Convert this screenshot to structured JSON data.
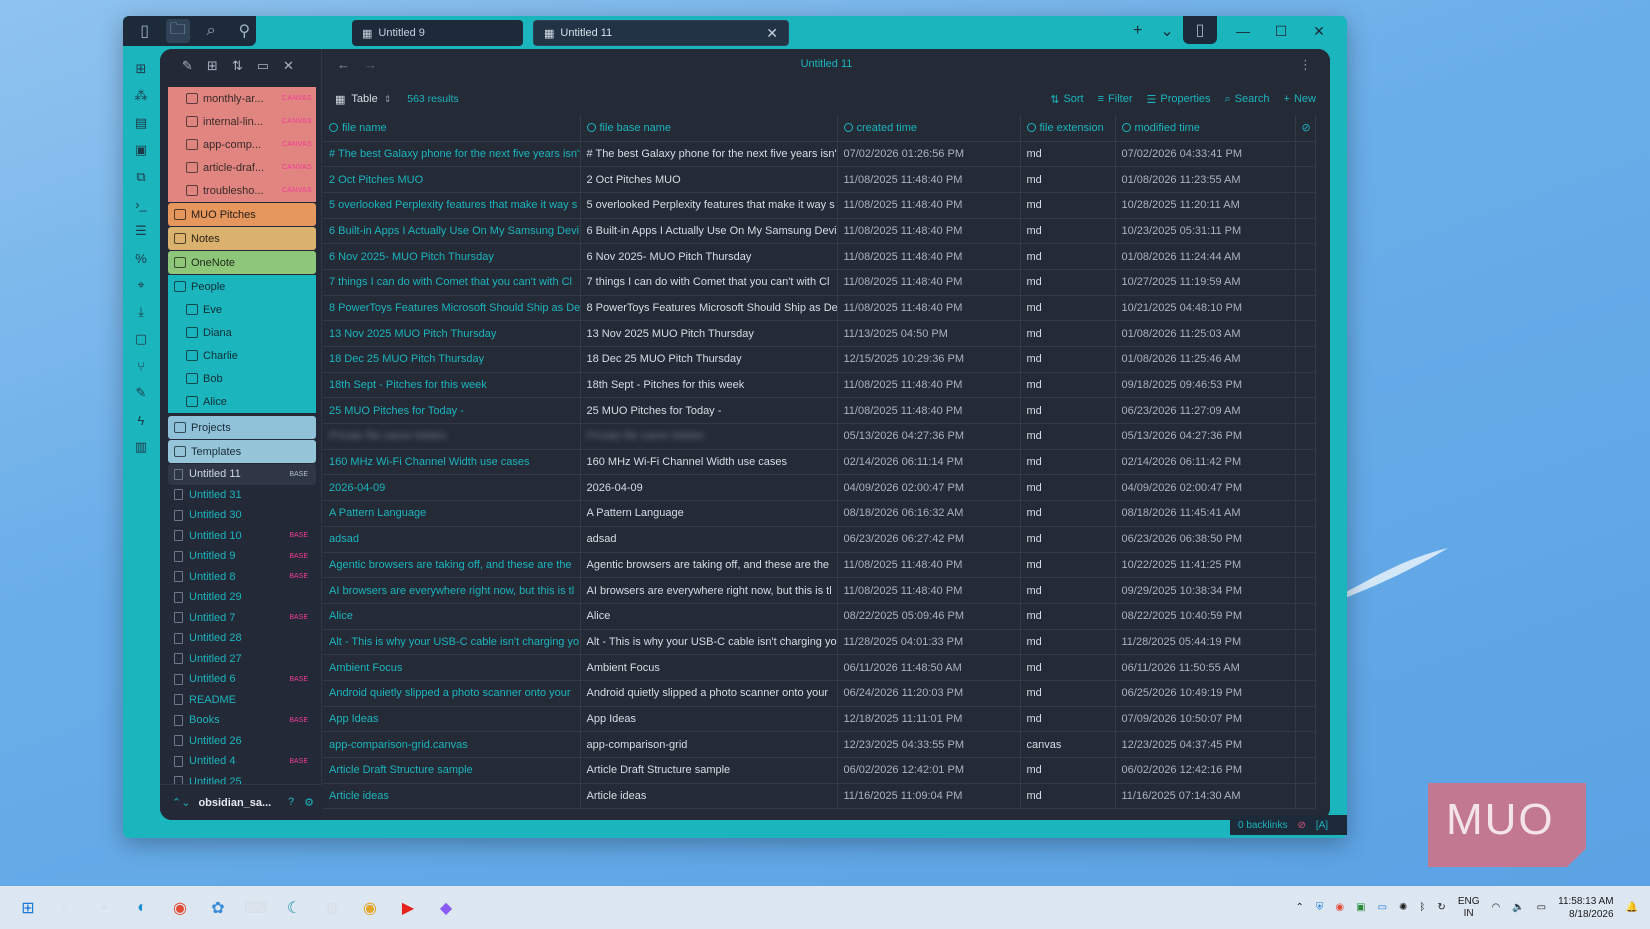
{
  "titlebar": {
    "tabs": [
      {
        "label": "Untitled 9"
      },
      {
        "label": "Untitled 11"
      }
    ],
    "close_glyph": "✕",
    "new_tab": "+",
    "tab_list": "⌄"
  },
  "ribbon_icons": [
    "files-icon",
    "graph-icon",
    "page-icon",
    "calendar-icon",
    "copy-icon",
    "terminal-icon",
    "blocks-icon",
    "percent-icon",
    "map-pin-icon",
    "download-icon",
    "robot-icon",
    "branch-icon",
    "brush-icon",
    "bolt-icon",
    "clipboard-icon"
  ],
  "sidebar": {
    "red_group": [
      {
        "label": "monthly-ar...",
        "badge": "CANVAS"
      },
      {
        "label": "internal-lin...",
        "badge": "CANVAS"
      },
      {
        "label": "app-comp...",
        "badge": "CANVAS"
      },
      {
        "label": "article-draf...",
        "badge": "CANVAS"
      },
      {
        "label": "troublesho...",
        "badge": "CANVAS"
      }
    ],
    "folders_top": [
      {
        "label": "MUO Pitches",
        "style": "f-orange"
      },
      {
        "label": "Notes",
        "style": "f-yellow"
      },
      {
        "label": "OneNote",
        "style": "f-green"
      }
    ],
    "people": {
      "label": "People",
      "items": [
        "Eve",
        "Diana",
        "Charlie",
        "Bob",
        "Alice"
      ]
    },
    "folders_bottom": [
      {
        "label": "Projects",
        "style": "f-blue"
      },
      {
        "label": "Templates",
        "style": "f-lightblue"
      }
    ],
    "files": [
      {
        "label": "Untitled 11",
        "badge": "BASE",
        "active": true
      },
      {
        "label": "Untitled 31",
        "badge": ""
      },
      {
        "label": "Untitled 30",
        "badge": ""
      },
      {
        "label": "Untitled 10",
        "badge": "BASE"
      },
      {
        "label": "Untitled 9",
        "badge": "BASE"
      },
      {
        "label": "Untitled 8",
        "badge": "BASE"
      },
      {
        "label": "Untitled 29",
        "badge": ""
      },
      {
        "label": "Untitled 7",
        "badge": "BASE"
      },
      {
        "label": "Untitled 28",
        "badge": ""
      },
      {
        "label": "Untitled 27",
        "badge": ""
      },
      {
        "label": "Untitled 6",
        "badge": "BASE"
      },
      {
        "label": "README",
        "badge": ""
      },
      {
        "label": "Books",
        "badge": "BASE"
      },
      {
        "label": "Untitled 26",
        "badge": ""
      },
      {
        "label": "Untitled 4",
        "badge": "BASE"
      },
      {
        "label": "Untitled 25",
        "badge": ""
      }
    ],
    "vault_name": "obsidian_sa..."
  },
  "main": {
    "title": "Untitled 11",
    "view_label": "Table",
    "results": "563 results",
    "actions": {
      "sort": "Sort",
      "filter": "Filter",
      "properties": "Properties",
      "search": "Search",
      "new": "New"
    },
    "columns": [
      "file name",
      "file base name",
      "created time",
      "file extension",
      "modified time"
    ],
    "rows": [
      [
        "# The best Galaxy phone for the next five years isn't",
        "# The best Galaxy phone for the next five years isn't",
        "07/02/2026 01:26:56 PM",
        "md",
        "07/02/2026 04:33:41 PM"
      ],
      [
        "2 Oct Pitches MUO",
        "2 Oct Pitches MUO",
        "11/08/2025 11:48:40 PM",
        "md",
        "01/08/2026 11:23:55 AM"
      ],
      [
        "5 overlooked Perplexity features that make it way s",
        "5 overlooked Perplexity features that make it way s",
        "11/08/2025 11:48:40 PM",
        "md",
        "10/28/2025 11:20:11 AM"
      ],
      [
        "6 Built-in Apps I Actually Use On My Samsung Devi",
        "6 Built-in Apps I Actually Use On My Samsung Devi",
        "11/08/2025 11:48:40 PM",
        "md",
        "10/23/2025 05:31:11 PM"
      ],
      [
        "6 Nov 2025- MUO Pitch Thursday",
        "6 Nov 2025- MUO Pitch Thursday",
        "11/08/2025 11:48:40 PM",
        "md",
        "01/08/2026 11:24:44 AM"
      ],
      [
        "7 things I can do with Comet that you can't with Cl",
        "7 things I can do with Comet that you can't with Cl",
        "11/08/2025 11:48:40 PM",
        "md",
        "10/27/2025 11:19:59 AM"
      ],
      [
        "8 PowerToys Features Microsoft Should Ship as De",
        "8 PowerToys Features Microsoft Should Ship as De",
        "11/08/2025 11:48:40 PM",
        "md",
        "10/21/2025 04:48:10 PM"
      ],
      [
        "13 Nov 2025 MUO Pitch Thursday",
        "13 Nov 2025 MUO Pitch Thursday",
        "11/13/2025 04:50 PM",
        "md",
        "01/08/2026 11:25:03 AM"
      ],
      [
        "18 Dec 25 MUO Pitch Thursday",
        "18 Dec 25 MUO Pitch Thursday",
        "12/15/2025 10:29:36 PM",
        "md",
        "01/08/2026 11:25:46 AM"
      ],
      [
        "18th Sept - Pitches for this week",
        "18th Sept - Pitches for this week",
        "11/08/2025 11:48:40 PM",
        "md",
        "09/18/2025 09:46:53 PM"
      ],
      [
        "25 MUO Pitches for Today -",
        "25 MUO Pitches for Today -",
        "11/08/2025 11:48:40 PM",
        "md",
        "06/23/2026 11:27:09 AM"
      ],
      [
        "Private file name hidden",
        "Private file name hidden",
        "05/13/2026 04:27:36 PM",
        "md",
        "05/13/2026 04:27:36 PM"
      ],
      [
        "160 MHz Wi-Fi Channel Width use cases",
        "160 MHz Wi-Fi Channel Width use cases",
        "02/14/2026 06:11:14 PM",
        "md",
        "02/14/2026 06:11:42 PM"
      ],
      [
        "2026-04-09",
        "2026-04-09",
        "04/09/2026 02:00:47 PM",
        "md",
        "04/09/2026 02:00:47 PM"
      ],
      [
        "A Pattern Language",
        "A Pattern Language",
        "08/18/2026 06:16:32 AM",
        "md",
        "08/18/2026 11:45:41 AM"
      ],
      [
        "adsad",
        "adsad",
        "06/23/2026 06:27:42 PM",
        "md",
        "06/23/2026 06:38:50 PM"
      ],
      [
        "Agentic browsers are taking off, and these are the",
        "Agentic browsers are taking off, and these are the",
        "11/08/2025 11:48:40 PM",
        "md",
        "10/22/2025 11:41:25 PM"
      ],
      [
        "AI browsers are everywhere right now, but this is tl",
        "AI browsers are everywhere right now, but this is tl",
        "11/08/2025 11:48:40 PM",
        "md",
        "09/29/2025 10:38:34 PM"
      ],
      [
        "Alice",
        "Alice",
        "08/22/2025 05:09:46 PM",
        "md",
        "08/22/2025 10:40:59 PM"
      ],
      [
        "Alt - This is why your USB-C cable isn't charging yo",
        "Alt - This is why your USB-C cable isn't charging yo",
        "11/28/2025 04:01:33 PM",
        "md",
        "11/28/2025 05:44:19 PM"
      ],
      [
        "Ambient Focus",
        "Ambient Focus",
        "06/11/2026 11:48:50 AM",
        "md",
        "06/11/2026 11:50:55 AM"
      ],
      [
        "Android quietly slipped a photo scanner onto your",
        "Android quietly slipped a photo scanner onto your",
        "06/24/2026 11:20:03 PM",
        "md",
        "06/25/2026 10:49:19 PM"
      ],
      [
        "App Ideas",
        "App Ideas",
        "12/18/2025 11:11:01 PM",
        "md",
        "07/09/2026 10:50:07 PM"
      ],
      [
        "app-comparison-grid.canvas",
        "app-comparison-grid",
        "12/23/2025 04:33:55 PM",
        "canvas",
        "12/23/2025 04:37:45 PM"
      ],
      [
        "Article Draft Structure sample",
        "Article Draft Structure sample",
        "06/02/2026 12:42:01 PM",
        "md",
        "06/02/2026 12:42:16 PM"
      ],
      [
        "Article ideas",
        "Article ideas",
        "11/16/2025 11:09:04 PM",
        "md",
        "11/16/2025 07:14:30 AM"
      ]
    ],
    "blur_row_index": 11
  },
  "statusbar": {
    "backlinks": "0 backlinks",
    "mode": "[A]"
  },
  "logo": {
    "text": "MUO"
  },
  "taskbar": {
    "lang_top": "ENG",
    "lang_bottom": "IN",
    "time": "11:58:13 AM",
    "date": "8/18/2026"
  }
}
